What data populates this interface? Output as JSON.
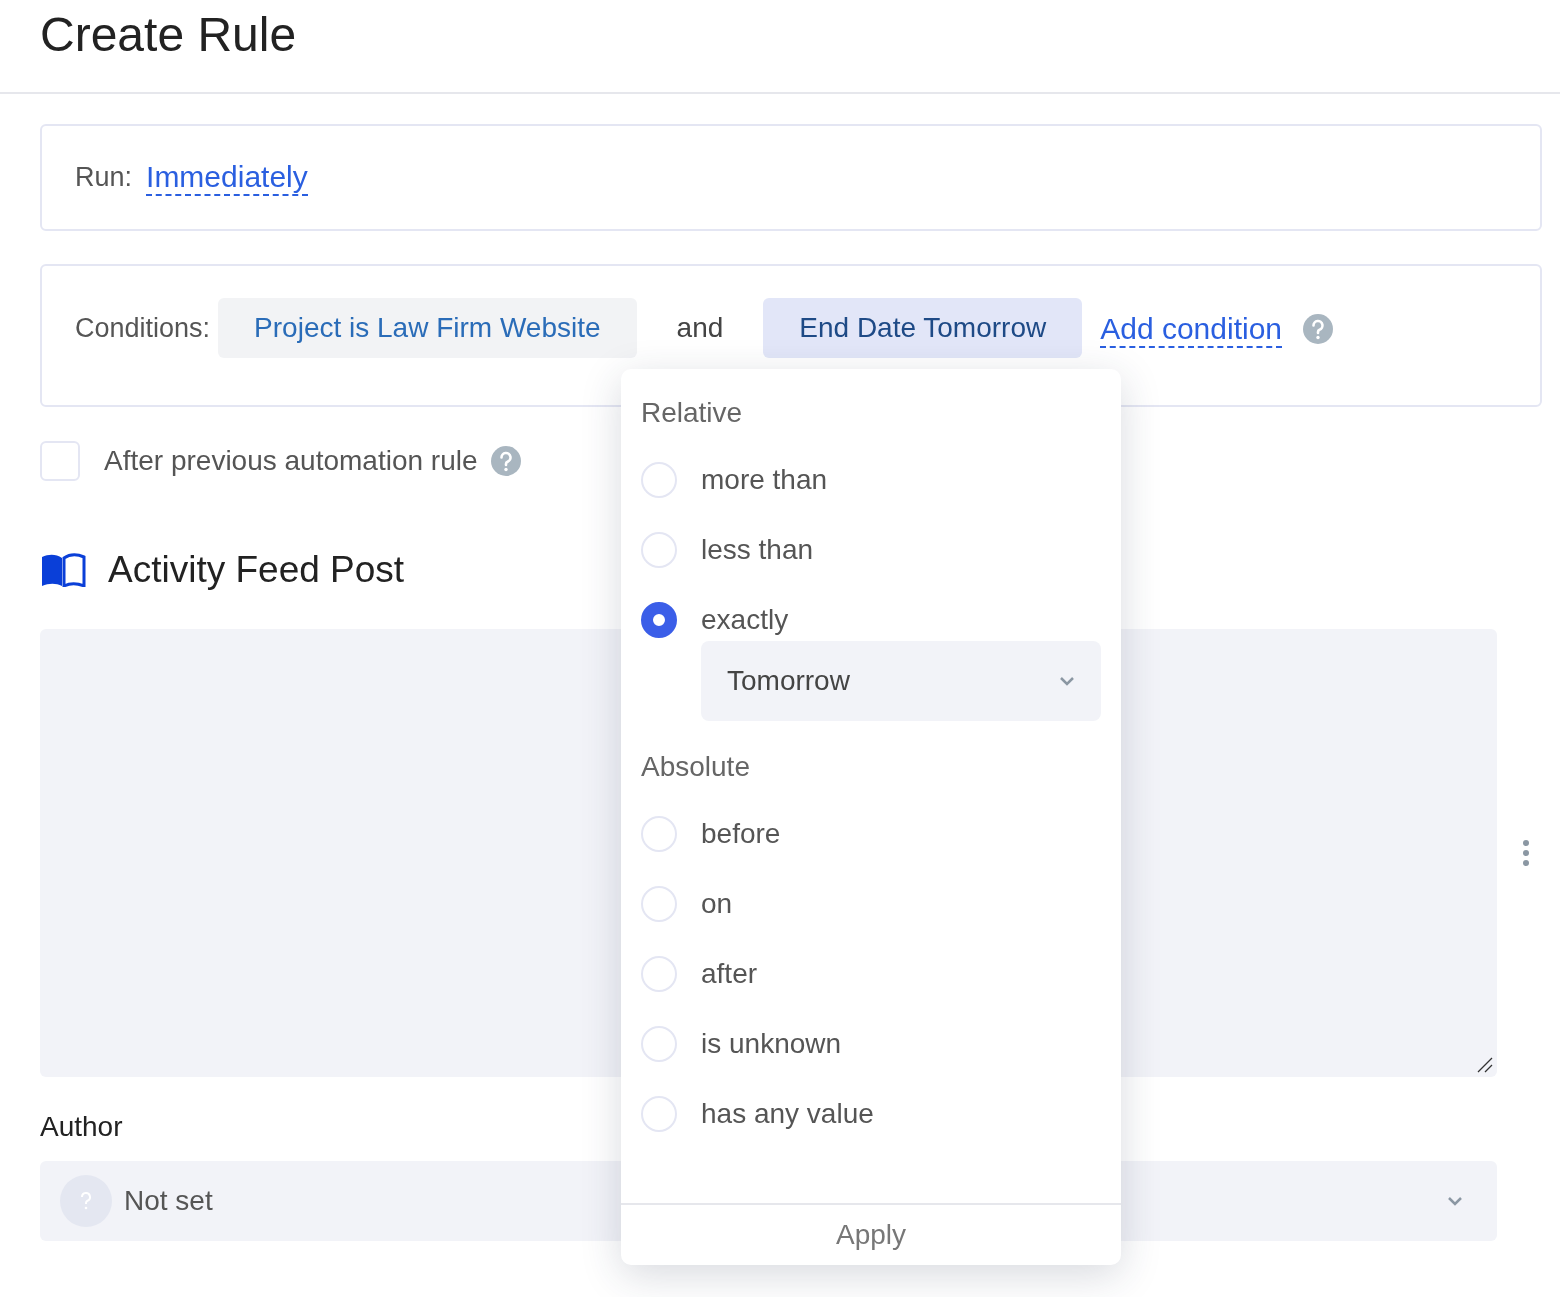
{
  "title": "Create Rule",
  "run": {
    "label": "Run:",
    "value": "Immediately"
  },
  "conditions": {
    "label": "Conditions:",
    "items": [
      {
        "text": "Project is Law Firm Website",
        "selected": false
      },
      {
        "text": "End Date Tomorrow",
        "selected": true
      }
    ],
    "joiner": "and",
    "add_link": "Add condition"
  },
  "after_previous": {
    "label": "After previous automation rule",
    "checked": false
  },
  "section": {
    "title": "Activity Feed Post"
  },
  "author": {
    "label": "Author",
    "value": "Not set"
  },
  "popup": {
    "groups": [
      {
        "title": "Relative",
        "options": [
          {
            "label": "more than",
            "selected": false
          },
          {
            "label": "less than",
            "selected": false
          },
          {
            "label": "exactly",
            "selected": true,
            "select_value": "Tomorrow"
          }
        ]
      },
      {
        "title": "Absolute",
        "options": [
          {
            "label": "before",
            "selected": false
          },
          {
            "label": "on",
            "selected": false
          },
          {
            "label": "after",
            "selected": false
          },
          {
            "label": "is unknown",
            "selected": false
          },
          {
            "label": "has any value",
            "selected": false
          }
        ]
      }
    ],
    "apply": "Apply"
  }
}
